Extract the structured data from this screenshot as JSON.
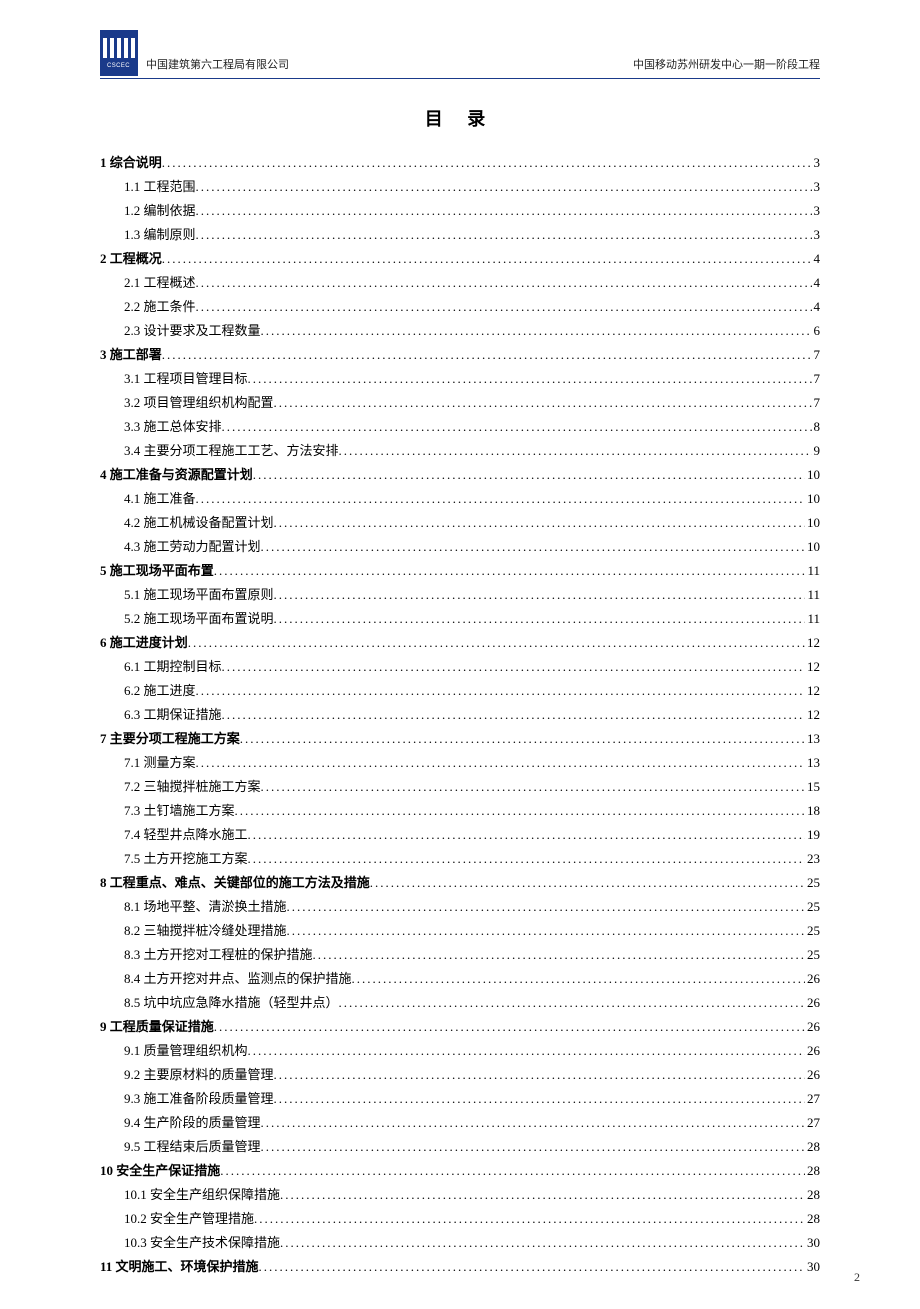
{
  "header": {
    "logo_text": "CSCEC",
    "company": "中国建筑第六工程局有限公司",
    "project": "中国移动苏州研发中心一期一阶段工程"
  },
  "title": "目 录",
  "toc": [
    {
      "level": 1,
      "text": "1 综合说明",
      "page": "3"
    },
    {
      "level": 2,
      "text": "1.1 工程范围",
      "page": "3"
    },
    {
      "level": 2,
      "text": "1.2 编制依据",
      "page": "3"
    },
    {
      "level": 2,
      "text": "1.3 编制原则",
      "page": "3"
    },
    {
      "level": 1,
      "text": "2 工程概况",
      "page": "4"
    },
    {
      "level": 2,
      "text": "2.1 工程概述",
      "page": "4"
    },
    {
      "level": 2,
      "text": "2.2 施工条件",
      "page": "4"
    },
    {
      "level": 2,
      "text": "2.3 设计要求及工程数量",
      "page": "6"
    },
    {
      "level": 1,
      "text": "3 施工部署",
      "page": "7"
    },
    {
      "level": 2,
      "text": "3.1 工程项目管理目标",
      "page": "7"
    },
    {
      "level": 2,
      "text": "3.2 项目管理组织机构配置",
      "page": "7"
    },
    {
      "level": 2,
      "text": "3.3 施工总体安排",
      "page": "8"
    },
    {
      "level": 2,
      "text": "3.4 主要分项工程施工工艺、方法安排",
      "page": "9"
    },
    {
      "level": 1,
      "text": "4 施工准备与资源配置计划",
      "page": "10"
    },
    {
      "level": 2,
      "text": "4.1 施工准备",
      "page": "10"
    },
    {
      "level": 2,
      "text": "4.2 施工机械设备配置计划",
      "page": "10"
    },
    {
      "level": 2,
      "text": "4.3 施工劳动力配置计划",
      "page": "10"
    },
    {
      "level": 1,
      "text": "5 施工现场平面布置",
      "page": "11"
    },
    {
      "level": 2,
      "text": "5.1 施工现场平面布置原则",
      "page": "11"
    },
    {
      "level": 2,
      "text": "5.2 施工现场平面布置说明",
      "page": "11"
    },
    {
      "level": 1,
      "text": "6 施工进度计划",
      "page": "12"
    },
    {
      "level": 2,
      "text": "6.1 工期控制目标",
      "page": "12"
    },
    {
      "level": 2,
      "text": "6.2 施工进度",
      "page": "12"
    },
    {
      "level": 2,
      "text": "6.3 工期保证措施",
      "page": "12"
    },
    {
      "level": 1,
      "text": "7 主要分项工程施工方案",
      "page": "13"
    },
    {
      "level": 2,
      "text": "7.1 测量方案",
      "page": "13"
    },
    {
      "level": 2,
      "text": "7.2 三轴搅拌桩施工方案",
      "page": "15"
    },
    {
      "level": 2,
      "text": "7.3 土钉墙施工方案",
      "page": "18"
    },
    {
      "level": 2,
      "text": "7.4 轻型井点降水施工",
      "page": "19"
    },
    {
      "level": 2,
      "text": "7.5 土方开挖施工方案",
      "page": "23"
    },
    {
      "level": 1,
      "text": "8 工程重点、难点、关键部位的施工方法及措施",
      "page": "25"
    },
    {
      "level": 2,
      "text": "8.1 场地平整、清淤换土措施",
      "page": "25"
    },
    {
      "level": 2,
      "text": "8.2 三轴搅拌桩冷缝处理措施",
      "page": "25"
    },
    {
      "level": 2,
      "text": "8.3 土方开挖对工程桩的保护措施",
      "page": "25"
    },
    {
      "level": 2,
      "text": "8.4 土方开挖对井点、监测点的保护措施",
      "page": "26"
    },
    {
      "level": 2,
      "text": "8.5 坑中坑应急降水措施（轻型井点）",
      "page": "26"
    },
    {
      "level": 1,
      "text": "9 工程质量保证措施",
      "page": "26"
    },
    {
      "level": 2,
      "text": "9.1 质量管理组织机构",
      "page": "26"
    },
    {
      "level": 2,
      "text": "9.2 主要原材料的质量管理",
      "page": "26"
    },
    {
      "level": 2,
      "text": "9.3 施工准备阶段质量管理",
      "page": "27"
    },
    {
      "level": 2,
      "text": "9.4 生产阶段的质量管理",
      "page": "27"
    },
    {
      "level": 2,
      "text": "9.5 工程结束后质量管理",
      "page": "28"
    },
    {
      "level": 1,
      "text": "10 安全生产保证措施",
      "page": "28"
    },
    {
      "level": 2,
      "text": "10.1 安全生产组织保障措施",
      "page": "28"
    },
    {
      "level": 2,
      "text": "10.2 安全生产管理措施",
      "page": "28"
    },
    {
      "level": 2,
      "text": "10.3 安全生产技术保障措施",
      "page": "30"
    },
    {
      "level": 1,
      "text": "11 文明施工、环境保护措施",
      "page": "30"
    }
  ],
  "page_number": "2"
}
